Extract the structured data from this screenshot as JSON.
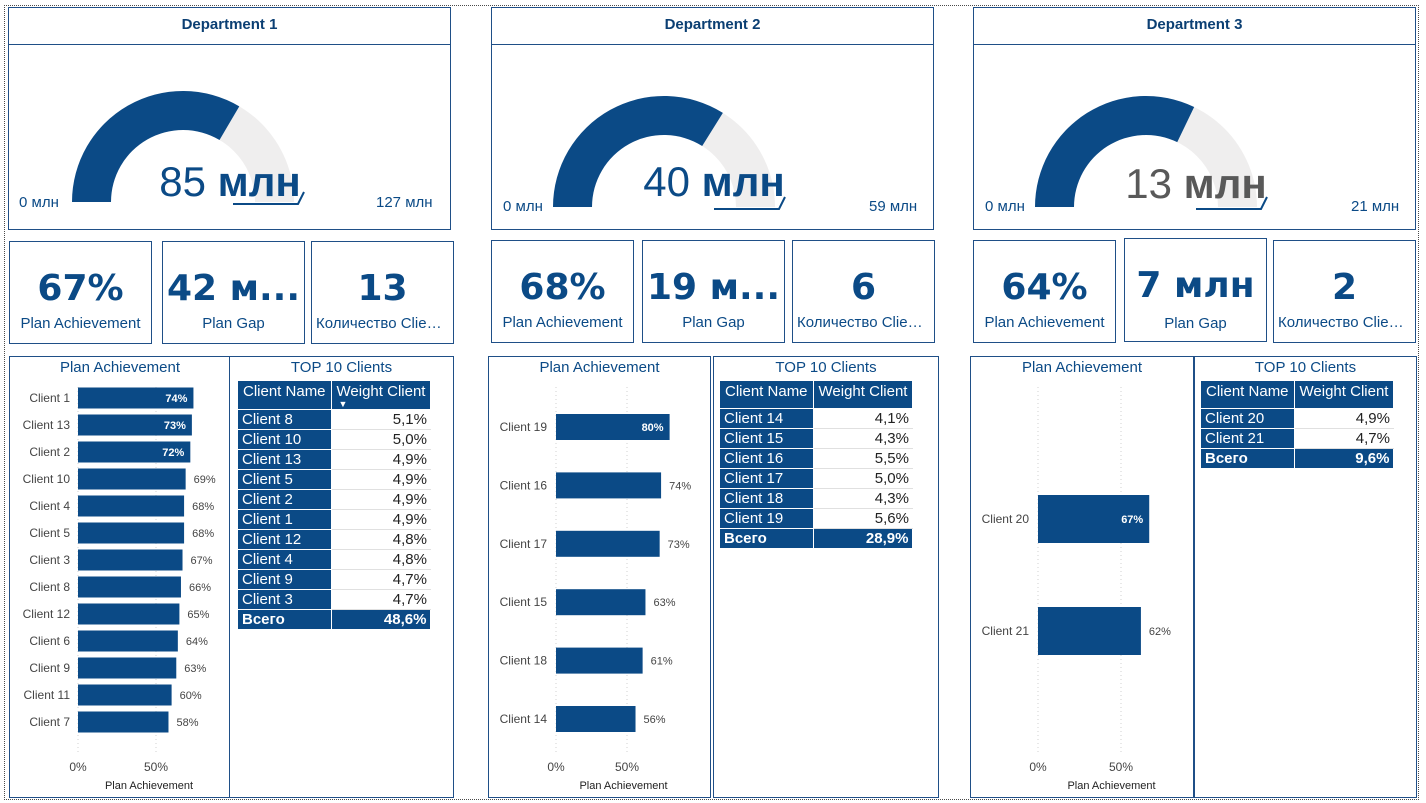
{
  "departments": [
    {
      "title": "Department 1",
      "gauge": {
        "value_num": "85",
        "value_unit": "млн",
        "min_label": "0 млн",
        "max_label": "127 млн",
        "value": 85,
        "max": 127,
        "target": 127,
        "grey_value": false
      },
      "cards": [
        {
          "value": "67%",
          "label": "Plan Achievement"
        },
        {
          "value": "42 м...",
          "label": "Plan Gap"
        },
        {
          "value": "13",
          "label": "Количество Client..."
        }
      ],
      "chart": {
        "title": "Plan Achievement",
        "xlabel": "Plan Achievement",
        "ticks": [
          "0%",
          "50%"
        ],
        "inside_threshold": 70
      },
      "table": {
        "title": "TOP 10 Clients",
        "headers": [
          "Client Name",
          "Weight Client"
        ],
        "sorted_col": 1,
        "rows": [
          [
            "Client 8",
            "5,1%"
          ],
          [
            "Client 10",
            "5,0%"
          ],
          [
            "Client 13",
            "4,9%"
          ],
          [
            "Client 5",
            "4,9%"
          ],
          [
            "Client 2",
            "4,9%"
          ],
          [
            "Client 1",
            "4,9%"
          ],
          [
            "Client 12",
            "4,8%"
          ],
          [
            "Client 4",
            "4,8%"
          ],
          [
            "Client 9",
            "4,7%"
          ],
          [
            "Client 3",
            "4,7%"
          ]
        ],
        "total": [
          "Всего",
          "48,6%"
        ]
      }
    },
    {
      "title": "Department 2",
      "gauge": {
        "value_num": "40",
        "value_unit": "млн",
        "min_label": "0 млн",
        "max_label": "59 млн",
        "value": 40,
        "max": 59,
        "target": 59,
        "grey_value": false
      },
      "cards": [
        {
          "value": "68%",
          "label": "Plan Achievement"
        },
        {
          "value": "19 м...",
          "label": "Plan Gap"
        },
        {
          "value": "6",
          "label": "Количество Client..."
        }
      ],
      "chart": {
        "title": "Plan Achievement",
        "xlabel": "Plan Achievement",
        "ticks": [
          "0%",
          "50%"
        ],
        "inside_threshold": 75
      },
      "table": {
        "title": "TOP 10 Clients",
        "headers": [
          "Client Name",
          "Weight Client"
        ],
        "sorted_col": -1,
        "rows": [
          [
            "Client 14",
            "4,1%"
          ],
          [
            "Client 15",
            "4,3%"
          ],
          [
            "Client 16",
            "5,5%"
          ],
          [
            "Client 17",
            "5,0%"
          ],
          [
            "Client 18",
            "4,3%"
          ],
          [
            "Client 19",
            "5,6%"
          ]
        ],
        "total": [
          "Всего",
          "28,9%"
        ]
      }
    },
    {
      "title": "Department 3",
      "gauge": {
        "value_num": "13",
        "value_unit": "млн",
        "min_label": "0 млн",
        "max_label": "21 млн",
        "value": 13.5,
        "max": 21,
        "target": 21,
        "grey_value": true
      },
      "cards": [
        {
          "value": "64%",
          "label": "Plan Achievement"
        },
        {
          "value": "7 млн",
          "label": "Plan Gap"
        },
        {
          "value": "2",
          "label": "Количество Client..."
        }
      ],
      "chart": {
        "title": "Plan Achievement",
        "xlabel": "Plan Achievement",
        "ticks": [
          "0%",
          "50%"
        ],
        "inside_threshold": 65
      },
      "table": {
        "title": "TOP 10 Clients",
        "headers": [
          "Client Name",
          "Weight Client"
        ],
        "sorted_col": -1,
        "rows": [
          [
            "Client 20",
            "4,9%"
          ],
          [
            "Client 21",
            "4,7%"
          ]
        ],
        "total": [
          "Всего",
          "9,6%"
        ]
      }
    }
  ],
  "chart_data": [
    {
      "type": "bar",
      "orientation": "horizontal",
      "title": "Plan Achievement",
      "xlabel": "Plan Achievement",
      "categories": [
        "Client 1",
        "Client 13",
        "Client 2",
        "Client 10",
        "Client 4",
        "Client 5",
        "Client 3",
        "Client 8",
        "Client 12",
        "Client 6",
        "Client 9",
        "Client 11",
        "Client 7"
      ],
      "values": [
        74,
        73,
        72,
        69,
        68,
        68,
        67,
        66,
        65,
        64,
        63,
        60,
        58
      ],
      "labels": [
        "74%",
        "73%",
        "72%",
        "69%",
        "68%",
        "68%",
        "67%",
        "66%",
        "65%",
        "64%",
        "63%",
        "60%",
        "58%"
      ],
      "xlim": [
        0,
        100
      ],
      "x_ticks": [
        "0%",
        "50%"
      ],
      "grid": true,
      "color": "#0b4a86"
    },
    {
      "type": "bar",
      "orientation": "horizontal",
      "title": "Plan Achievement",
      "xlabel": "Plan Achievement",
      "categories": [
        "Client 19",
        "Client 16",
        "Client 17",
        "Client 15",
        "Client 18",
        "Client 14"
      ],
      "values": [
        80,
        74,
        73,
        63,
        61,
        56
      ],
      "labels": [
        "80%",
        "74%",
        "73%",
        "63%",
        "61%",
        "56%"
      ],
      "xlim": [
        0,
        100
      ],
      "x_ticks": [
        "0%",
        "50%"
      ],
      "grid": true,
      "color": "#0b4a86"
    },
    {
      "type": "bar",
      "orientation": "horizontal",
      "title": "Plan Achievement",
      "xlabel": "Plan Achievement",
      "categories": [
        "Client 20",
        "Client 21"
      ],
      "values": [
        67,
        62
      ],
      "labels": [
        "67%",
        "62%"
      ],
      "xlim": [
        0,
        100
      ],
      "x_ticks": [
        "0%",
        "50%"
      ],
      "grid": true,
      "color": "#0b4a86"
    }
  ],
  "colors": {
    "accent": "#0b4a86",
    "gauge_track": "#efeeee",
    "border": "#1f4f87"
  }
}
